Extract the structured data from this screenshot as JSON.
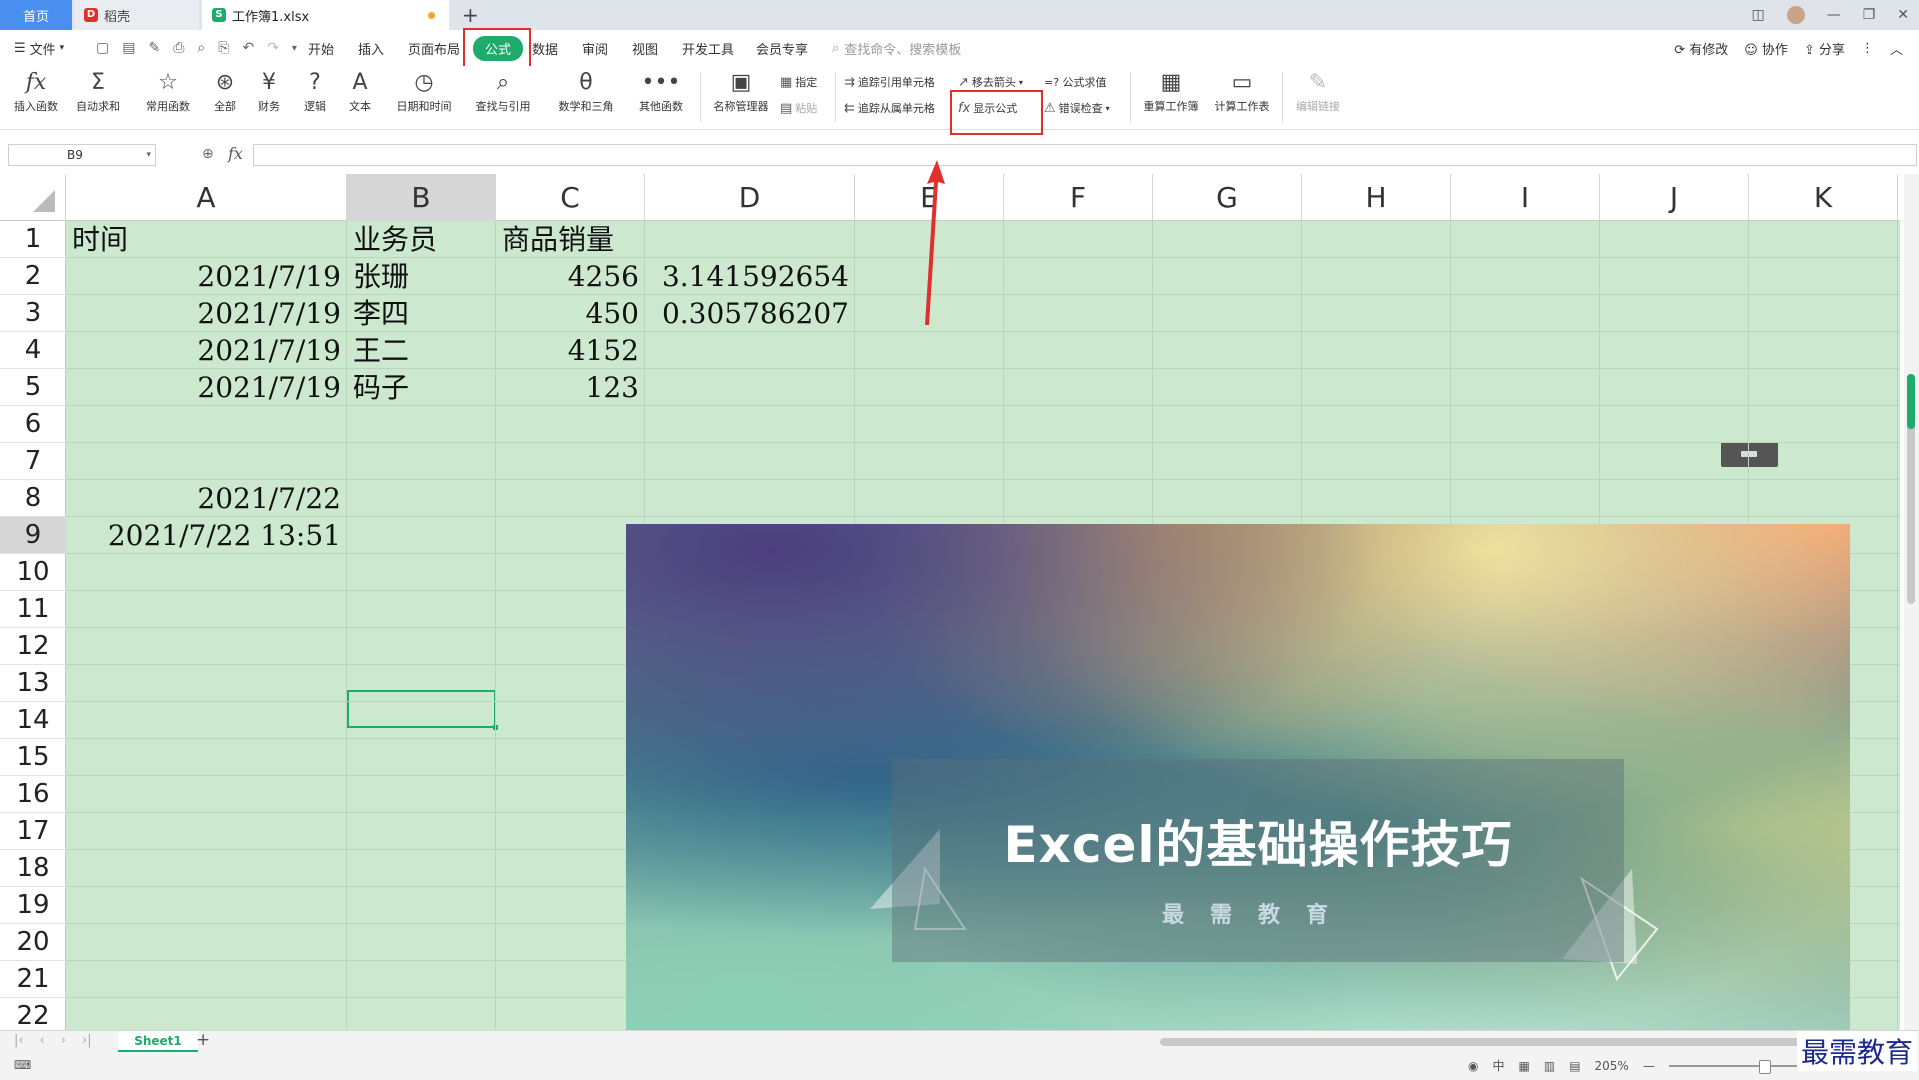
{
  "tabs": {
    "home": "首页",
    "shell": "稻壳",
    "workbook": "工作簿1.xlsx"
  },
  "menu": {
    "file": "文件",
    "items": [
      "开始",
      "插入",
      "页面布局",
      "公式",
      "数据",
      "审阅",
      "视图",
      "开发工具",
      "会员专享"
    ],
    "active": "公式",
    "search_placeholder": "查找命令、搜索模板",
    "has_changes": "有修改",
    "collaborate": "协作",
    "share": "分享"
  },
  "ribbon": {
    "insert_function": "插入函数",
    "autosum": "自动求和",
    "common_functions": "常用函数",
    "all": "全部",
    "finance": "财务",
    "logic": "逻辑",
    "text": "文本",
    "datetime": "日期和时间",
    "lookup": "查找与引用",
    "math": "数学和三角",
    "other": "其他函数",
    "name_manager": "名称管理器",
    "specify": "指定",
    "paste": "粘贴",
    "trace_precedents": "追踪引用单元格",
    "trace_dependents": "追踪从属单元格",
    "remove_arrows": "移去箭头",
    "evaluate_formula": "=? 公式求值",
    "show_formulas": "显示公式",
    "error_checking": "错误检查",
    "recalc_workbook": "重算工作簿",
    "calc_sheet": "计算工作表",
    "edit_links": "编辑链接"
  },
  "formula_bar": {
    "name_box": "B9",
    "fx": "fx",
    "content": ""
  },
  "grid": {
    "columns": [
      "A",
      "B",
      "C",
      "D",
      "E",
      "F",
      "G",
      "H",
      "I",
      "J",
      "K"
    ],
    "selected_column": "B",
    "rows": [
      "1",
      "2",
      "3",
      "4",
      "5",
      "6",
      "7",
      "8",
      "9",
      "10",
      "11",
      "12",
      "13",
      "14",
      "15",
      "16",
      "17",
      "18",
      "19",
      "20",
      "21",
      "22"
    ],
    "selected_row": "9",
    "cells": {
      "A1": "时间",
      "B1": "业务员",
      "C1": "商品销量",
      "A2": "2021/7/19",
      "B2": "张珊",
      "C2": "4256",
      "D2": "3.141592654",
      "A3": "2021/7/19",
      "B3": "李四",
      "C3": "450",
      "D3": "0.305786207",
      "A4": "2021/7/19",
      "B4": "王二",
      "C4": "4152",
      "A5": "2021/7/19",
      "B5": "码子",
      "C5": "123",
      "A8": "2021/7/22",
      "A9": "2021/7/22 13:51"
    }
  },
  "banner": {
    "title": "Excel的基础操作技巧",
    "subtitle": "最需教育"
  },
  "sheets": {
    "active": "Sheet1"
  },
  "status": {
    "zoom": "205%"
  },
  "watermark": "最需教育",
  "colors": {
    "accent": "#1fab6b",
    "highlight_red": "#e0302c",
    "grid_bg": "#cce8cf"
  }
}
